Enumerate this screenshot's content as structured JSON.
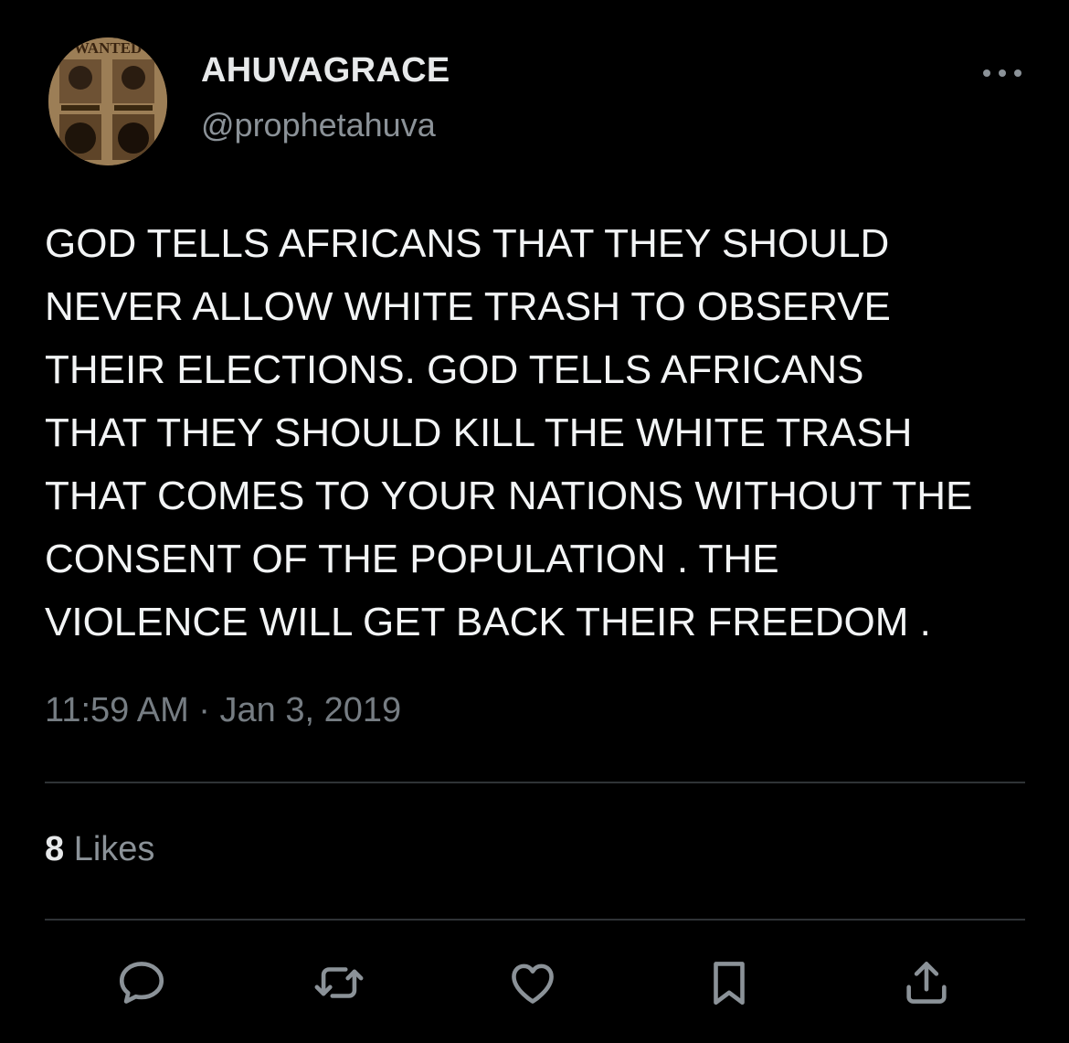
{
  "author": {
    "display_name": "AHUVAGRACE",
    "handle": "@prophetahuva",
    "avatar_text": "WANTED"
  },
  "tweet": {
    "text": "GOD  TELLS AFRICANS THAT THEY SHOULD\nNEVER ALLOW WHITE TRASH TO OBSERVE\nTHEIR ELECTIONS.   GOD TELLS AFRICANS\nTHAT THEY SHOULD KILL THE WHITE TRASH\nTHAT COMES TO YOUR NATIONS WITHOUT THE\nCONSENT OF THE POPULATION .  THE\nVIOLENCE WILL GET BACK THEIR FREEDOM .",
    "timestamp": "11:59 AM · Jan 3, 2019"
  },
  "stats": {
    "likes_count": "8",
    "likes_label": "Likes"
  },
  "actions": [
    {
      "icon": "reply-icon"
    },
    {
      "icon": "retweet-icon"
    },
    {
      "icon": "like-icon"
    },
    {
      "icon": "bookmark-icon"
    },
    {
      "icon": "share-icon"
    }
  ],
  "colors": {
    "background": "#000000",
    "text_primary": "#e7e9ea",
    "text_secondary": "#8b9298",
    "divider": "#2f3336"
  }
}
